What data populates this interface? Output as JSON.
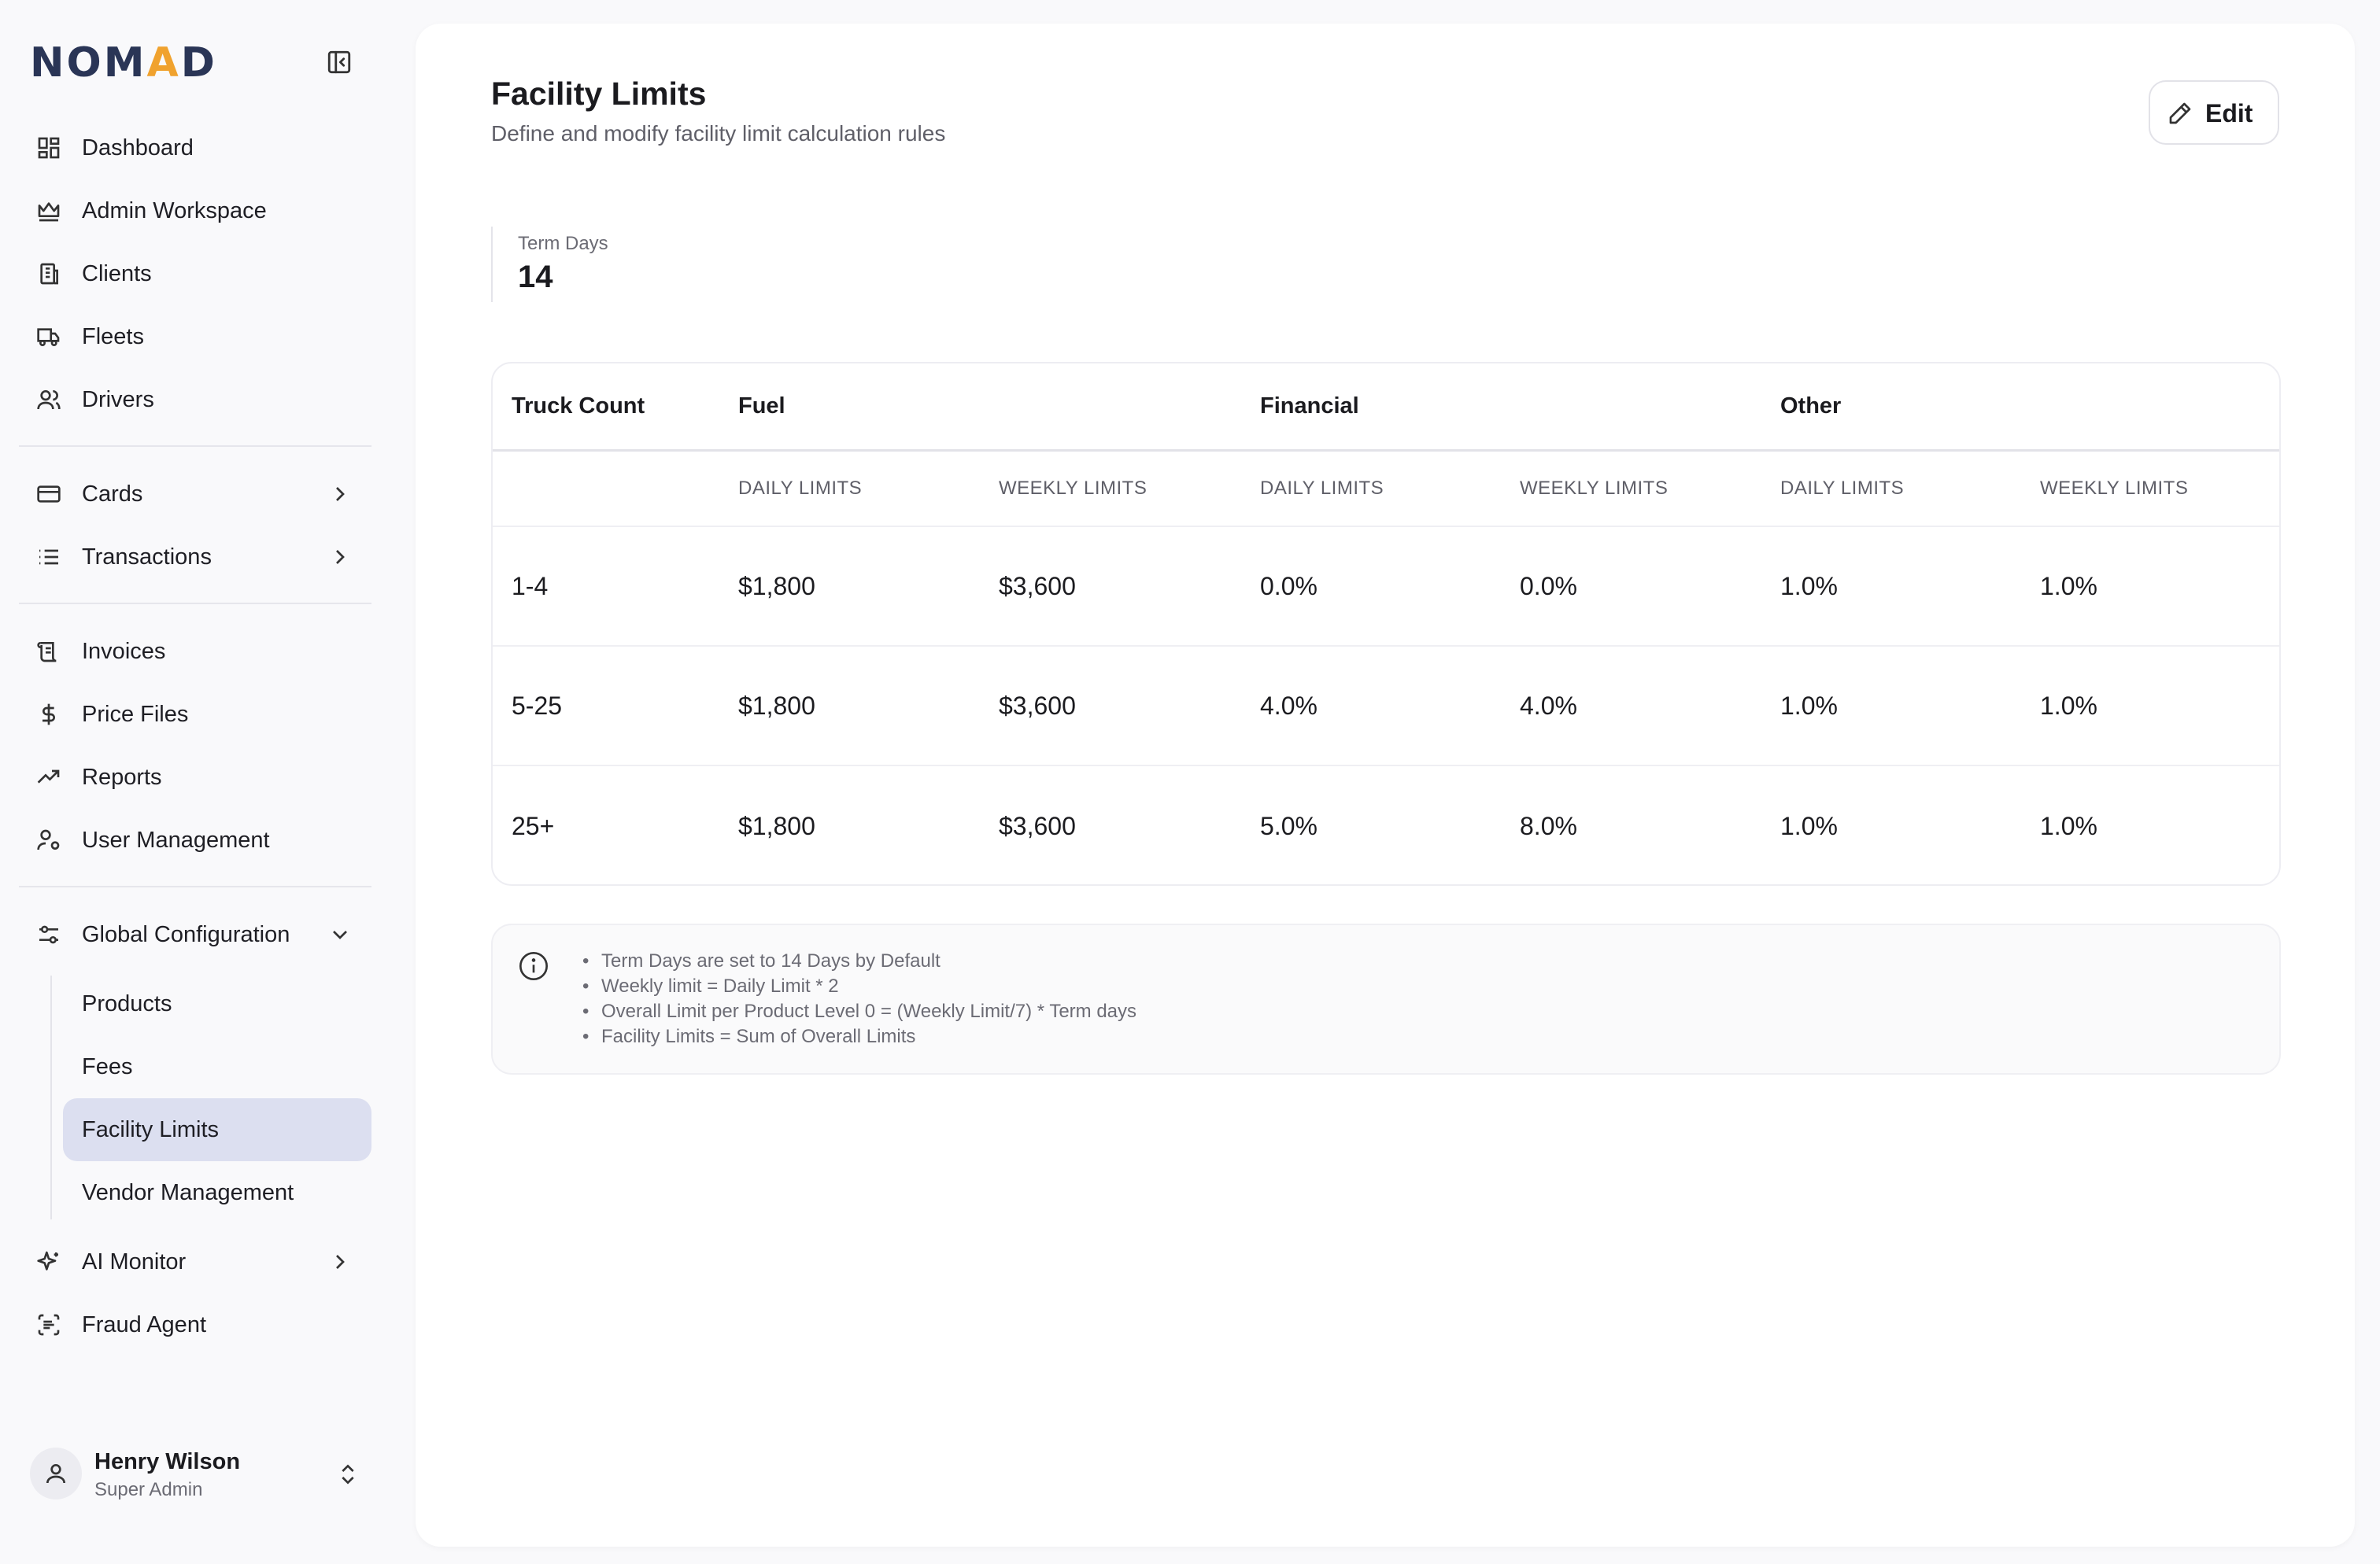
{
  "brand": {
    "logo_a": "NOM",
    "logo_b": "A",
    "logo_c": "D"
  },
  "sidebar": {
    "items": [
      {
        "label": "Dashboard"
      },
      {
        "label": "Admin Workspace"
      },
      {
        "label": "Clients"
      },
      {
        "label": "Fleets"
      },
      {
        "label": "Drivers"
      },
      {
        "label": "Cards"
      },
      {
        "label": "Transactions"
      },
      {
        "label": "Invoices"
      },
      {
        "label": "Price Files"
      },
      {
        "label": "Reports"
      },
      {
        "label": "User Management"
      },
      {
        "label": "Global Configuration"
      },
      {
        "label": "AI Monitor"
      },
      {
        "label": "Fraud Agent"
      }
    ],
    "sub_items": [
      {
        "label": "Products"
      },
      {
        "label": "Fees"
      },
      {
        "label": "Facility Limits"
      },
      {
        "label": "Vendor Management"
      }
    ]
  },
  "user": {
    "name": "Henry Wilson",
    "role": "Super Admin"
  },
  "page": {
    "title": "Facility Limits",
    "subtitle": "Define and modify facility limit calculation rules",
    "edit_label": "Edit"
  },
  "term": {
    "label": "Term Days",
    "value": "14"
  },
  "table": {
    "group_headers": [
      "Truck Count",
      "Fuel",
      "Financial",
      "Other"
    ],
    "sub_headers": [
      "DAILY LIMITS",
      "WEEKLY LIMITS",
      "DAILY LIMITS",
      "WEEKLY LIMITS",
      "DAILY LIMITS",
      "WEEKLY LIMITS"
    ],
    "rows": [
      [
        "1-4",
        "$1,800",
        "$3,600",
        "0.0%",
        "0.0%",
        "1.0%",
        "1.0%"
      ],
      [
        "5-25",
        "$1,800",
        "$3,600",
        "4.0%",
        "4.0%",
        "1.0%",
        "1.0%"
      ],
      [
        "25+",
        "$1,800",
        "$3,600",
        "5.0%",
        "8.0%",
        "1.0%",
        "1.0%"
      ]
    ]
  },
  "notes": [
    "Term Days are set to 14 Days by Default",
    "Weekly limit = Daily Limit * 2",
    "Overall Limit per Product Level 0 = (Weekly Limit/7) * Term days",
    "Facility Limits = Sum of Overall Limits"
  ],
  "colors": {
    "brand_navy": "#2a3556",
    "brand_orange": "#f0a22e",
    "active_bg": "#dcdff0"
  }
}
